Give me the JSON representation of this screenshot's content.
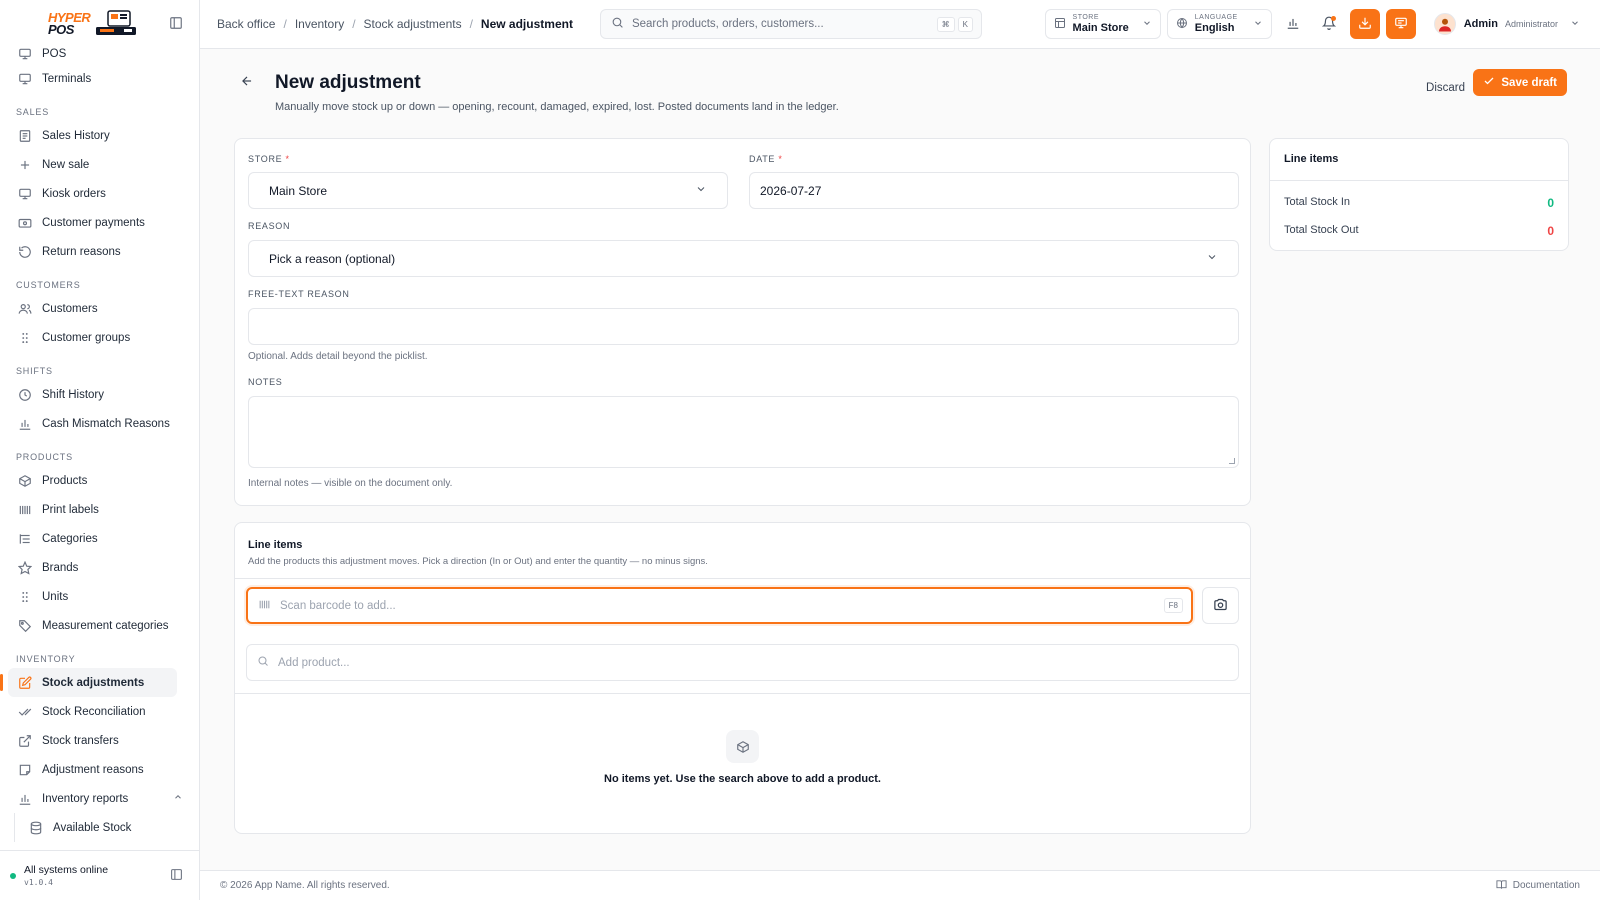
{
  "brand": {
    "line1": "HYPER",
    "line2": "POS"
  },
  "sidebar": {
    "top_items": [
      {
        "label": "POS",
        "icon": "monitor-icon"
      },
      {
        "label": "Terminals",
        "icon": "monitor-icon"
      }
    ],
    "sections": [
      {
        "title": "SALES",
        "items": [
          {
            "label": "Sales History",
            "icon": "receipt-icon"
          },
          {
            "label": "New sale",
            "icon": "plus-icon"
          },
          {
            "label": "Kiosk orders",
            "icon": "monitor-icon"
          },
          {
            "label": "Customer payments",
            "icon": "wallet-icon"
          },
          {
            "label": "Return reasons",
            "icon": "rotate-icon"
          }
        ]
      },
      {
        "title": "CUSTOMERS",
        "items": [
          {
            "label": "Customers",
            "icon": "users-icon"
          },
          {
            "label": "Customer groups",
            "icon": "grip-icon"
          }
        ]
      },
      {
        "title": "SHIFTS",
        "items": [
          {
            "label": "Shift History",
            "icon": "clock-icon"
          },
          {
            "label": "Cash Mismatch Reasons",
            "icon": "bar-chart-icon"
          }
        ]
      },
      {
        "title": "PRODUCTS",
        "items": [
          {
            "label": "Products",
            "icon": "box-icon"
          },
          {
            "label": "Print labels",
            "icon": "barcode-icon"
          },
          {
            "label": "Categories",
            "icon": "list-tree-icon"
          },
          {
            "label": "Brands",
            "icon": "star-icon"
          },
          {
            "label": "Units",
            "icon": "grip-icon"
          },
          {
            "label": "Measurement categories",
            "icon": "tag-icon"
          }
        ]
      },
      {
        "title": "INVENTORY",
        "items": [
          {
            "label": "Stock adjustments",
            "icon": "edit-icon",
            "active": true
          },
          {
            "label": "Stock Reconciliation",
            "icon": "check-check-icon"
          },
          {
            "label": "Stock transfers",
            "icon": "external-link-icon"
          },
          {
            "label": "Adjustment reasons",
            "icon": "note-icon"
          },
          {
            "label": "Inventory reports",
            "icon": "bar-chart-icon"
          },
          {
            "label": "Available Stock",
            "icon": "database-icon"
          }
        ]
      }
    ],
    "footer": {
      "status": "All systems online",
      "version": "v1.0.4"
    }
  },
  "topbar": {
    "breadcrumbs": [
      "Back office",
      "Inventory",
      "Stock adjustments",
      "New adjustment"
    ],
    "search_placeholder": "Search products, orders, customers...",
    "search_kbd": [
      "⌘",
      "K"
    ],
    "store": {
      "label": "STORE",
      "value": "Main Store"
    },
    "language": {
      "label": "LANGUAGE",
      "value": "English"
    },
    "user": {
      "name": "Admin",
      "role": "Administrator"
    }
  },
  "page": {
    "title": "New adjustment",
    "subtitle": "Manually move stock up or down — opening, recount, damaged, expired, lost. Posted documents land in the ledger.",
    "discard_label": "Discard",
    "save_label": "Save draft"
  },
  "form": {
    "store_label": "STORE",
    "store_value": "Main Store",
    "date_label": "DATE",
    "date_value": "2026-07-27",
    "reason_label": "REASON",
    "reason_value": "Pick a reason (optional)",
    "free_text_label": "FREE-TEXT REASON",
    "free_text_value": "",
    "free_text_hint": "Optional. Adds detail beyond the picklist.",
    "notes_label": "NOTES",
    "notes_value": "",
    "notes_hint": "Internal notes — visible on the document only."
  },
  "summary": {
    "title": "Line items",
    "stock_in_label": "Total Stock In",
    "stock_in_value": "0",
    "stock_out_label": "Total Stock Out",
    "stock_out_value": "0"
  },
  "line_items": {
    "title": "Line items",
    "subtitle": "Add the products this adjustment moves. Pick a direction (In or Out) and enter the quantity — no minus signs.",
    "scan_placeholder": "Scan barcode to add...",
    "scan_kbd": "F8",
    "add_placeholder": "Add product...",
    "empty_text": "No items yet. Use the search above to add a product."
  },
  "footer": {
    "copyright": "© 2026 App Name. All rights reserved.",
    "docs_label": "Documentation"
  },
  "colors": {
    "accent": "#f97316",
    "positive": "#10b981",
    "negative": "#ef4444"
  }
}
